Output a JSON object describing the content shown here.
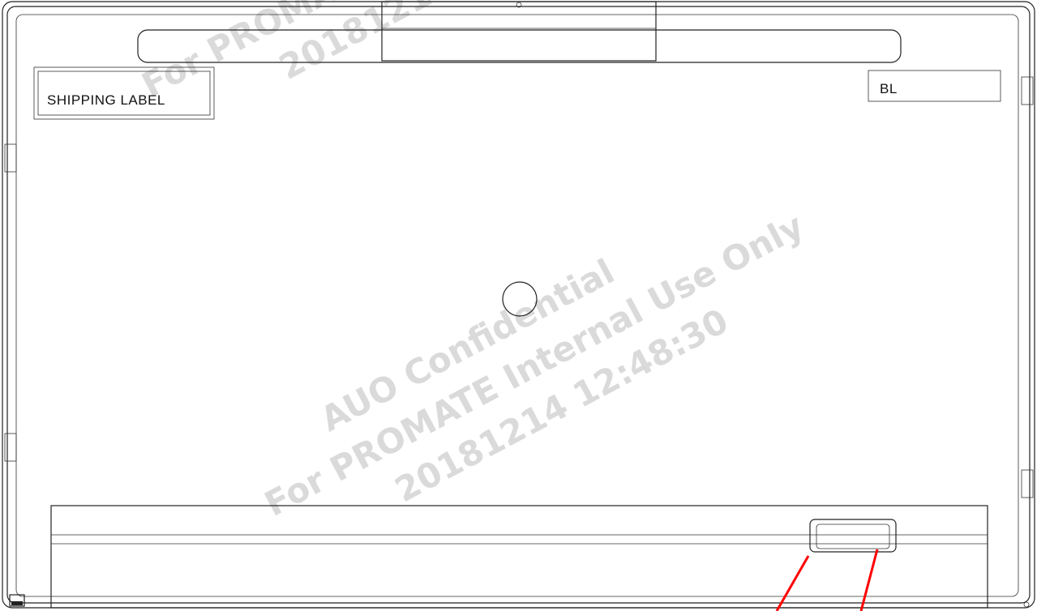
{
  "labels": {
    "shipping_label": "SHIPPING LABEL",
    "bl_label": "BL"
  },
  "watermark": {
    "line1": "AUO Confidential",
    "line2": "For PROMATE Internal Use Only",
    "line3": "20181214 12:48:30"
  },
  "colors": {
    "outline": "#222222",
    "watermark": "#bdbdbd",
    "callout": "#ff0000"
  }
}
